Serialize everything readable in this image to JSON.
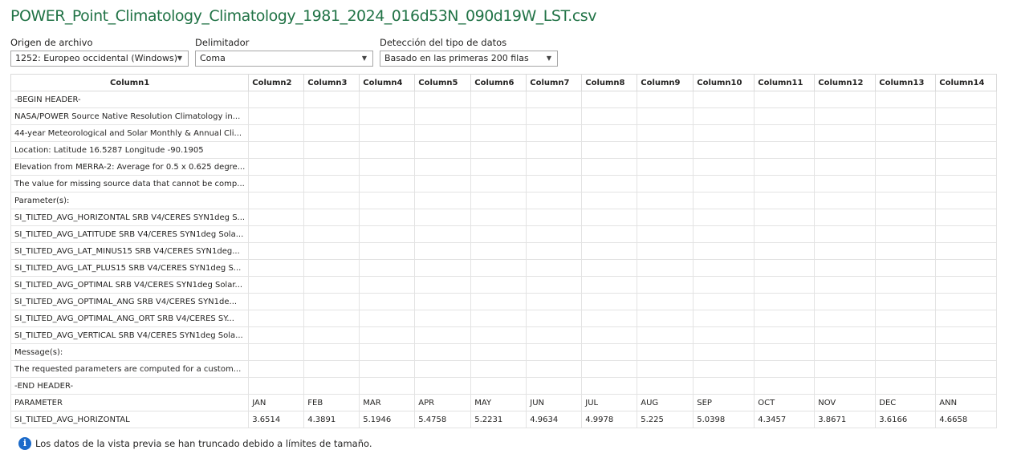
{
  "title": "POWER_Point_Climatology_Climatology_1981_2024_016d53N_090d19W_LST.csv",
  "controls": {
    "file_origin": {
      "label": "Origen de archivo",
      "value": "1252: Europeo occidental (Windows)"
    },
    "delimiter": {
      "label": "Delimitador",
      "value": "Coma"
    },
    "type_detection": {
      "label": "Detección del tipo de datos",
      "value": "Basado en las primeras 200 filas"
    }
  },
  "grid": {
    "headers": [
      "Column1",
      "Column2",
      "Column3",
      "Column4",
      "Column5",
      "Column6",
      "Column7",
      "Column8",
      "Column9",
      "Column10",
      "Column11",
      "Column12",
      "Column13",
      "Column14"
    ],
    "rows": [
      [
        "-BEGIN HEADER-",
        "",
        "",
        "",
        "",
        "",
        "",
        "",
        "",
        "",
        "",
        "",
        "",
        ""
      ],
      [
        "NASA/POWER Source Native Resolution Climatology in...",
        "",
        "",
        "",
        "",
        "",
        "",
        "",
        "",
        "",
        "",
        "",
        "",
        ""
      ],
      [
        "44-year Meteorological and Solar Monthly & Annual Cli...",
        "",
        "",
        "",
        "",
        "",
        "",
        "",
        "",
        "",
        "",
        "",
        "",
        ""
      ],
      [
        "Location: Latitude 16.5287 Longitude -90.1905",
        "",
        "",
        "",
        "",
        "",
        "",
        "",
        "",
        "",
        "",
        "",
        "",
        ""
      ],
      [
        "Elevation from MERRA-2: Average for 0.5 x 0.625 degre...",
        "",
        "",
        "",
        "",
        "",
        "",
        "",
        "",
        "",
        "",
        "",
        "",
        ""
      ],
      [
        "The value for missing source data that cannot be comp...",
        "",
        "",
        "",
        "",
        "",
        "",
        "",
        "",
        "",
        "",
        "",
        "",
        ""
      ],
      [
        "Parameter(s):",
        "",
        "",
        "",
        "",
        "",
        "",
        "",
        "",
        "",
        "",
        "",
        "",
        ""
      ],
      [
        "SI_TILTED_AVG_HORIZONTAL SRB V4/CERES SYN1deg S...",
        "",
        "",
        "",
        "",
        "",
        "",
        "",
        "",
        "",
        "",
        "",
        "",
        ""
      ],
      [
        "SI_TILTED_AVG_LATITUDE SRB V4/CERES SYN1deg Sola...",
        "",
        "",
        "",
        "",
        "",
        "",
        "",
        "",
        "",
        "",
        "",
        "",
        ""
      ],
      [
        "SI_TILTED_AVG_LAT_MINUS15 SRB V4/CERES SYN1deg...",
        "",
        "",
        "",
        "",
        "",
        "",
        "",
        "",
        "",
        "",
        "",
        "",
        ""
      ],
      [
        "SI_TILTED_AVG_LAT_PLUS15 SRB V4/CERES SYN1deg S...",
        "",
        "",
        "",
        "",
        "",
        "",
        "",
        "",
        "",
        "",
        "",
        "",
        ""
      ],
      [
        "SI_TILTED_AVG_OPTIMAL SRB V4/CERES SYN1deg Solar...",
        "",
        "",
        "",
        "",
        "",
        "",
        "",
        "",
        "",
        "",
        "",
        "",
        ""
      ],
      [
        "SI_TILTED_AVG_OPTIMAL_ANG SRB V4/CERES SYN1de...",
        "",
        "",
        "",
        "",
        "",
        "",
        "",
        "",
        "",
        "",
        "",
        "",
        ""
      ],
      [
        "SI_TILTED_AVG_OPTIMAL_ANG_ORT SRB V4/CERES SY...",
        "",
        "",
        "",
        "",
        "",
        "",
        "",
        "",
        "",
        "",
        "",
        "",
        ""
      ],
      [
        "SI_TILTED_AVG_VERTICAL SRB V4/CERES SYN1deg Sola...",
        "",
        "",
        "",
        "",
        "",
        "",
        "",
        "",
        "",
        "",
        "",
        "",
        ""
      ],
      [
        "Message(s):",
        "",
        "",
        "",
        "",
        "",
        "",
        "",
        "",
        "",
        "",
        "",
        "",
        ""
      ],
      [
        "The requested parameters are computed for a custom...",
        "",
        "",
        "",
        "",
        "",
        "",
        "",
        "",
        "",
        "",
        "",
        "",
        ""
      ],
      [
        "-END HEADER-",
        "",
        "",
        "",
        "",
        "",
        "",
        "",
        "",
        "",
        "",
        "",
        "",
        ""
      ],
      [
        "PARAMETER",
        "JAN",
        "FEB",
        "MAR",
        "APR",
        "MAY",
        "JUN",
        "JUL",
        "AUG",
        "SEP",
        "OCT",
        "NOV",
        "DEC",
        "ANN"
      ],
      [
        "SI_TILTED_AVG_HORIZONTAL",
        "3.6514",
        "4.3891",
        "5.1946",
        "5.4758",
        "5.2231",
        "4.9634",
        "4.9978",
        "5.225",
        "5.0398",
        "4.3457",
        "3.8671",
        "3.6166",
        "4.6658"
      ]
    ]
  },
  "footer": {
    "icon": "info-icon",
    "message": "Los datos de la vista previa se han truncado debido a límites de tamaño."
  },
  "colors": {
    "title": "#217346",
    "info_icon": "#1b6ac9"
  }
}
